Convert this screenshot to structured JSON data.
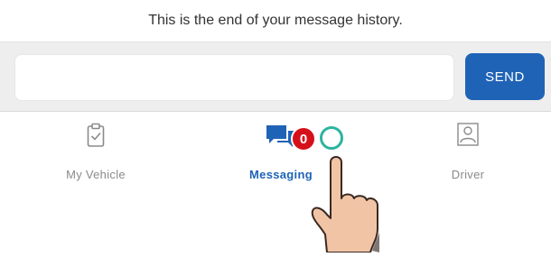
{
  "history": {
    "end_text": "This is the end of your message history."
  },
  "composer": {
    "input_value": "",
    "input_placeholder": "",
    "send_label": "SEND"
  },
  "tabs": [
    {
      "label": "My Vehicle",
      "icon": "clipboard-check-icon",
      "active": false
    },
    {
      "label": "Messaging",
      "icon": "chat-bubbles-icon",
      "active": true,
      "badge": "0"
    },
    {
      "label": "Driver",
      "icon": "person-icon",
      "active": false
    }
  ],
  "colors": {
    "accent": "#1f63b6",
    "badge": "#d6101a",
    "tap_ring": "#2db3a0",
    "inactive": "#8a8a8a"
  }
}
